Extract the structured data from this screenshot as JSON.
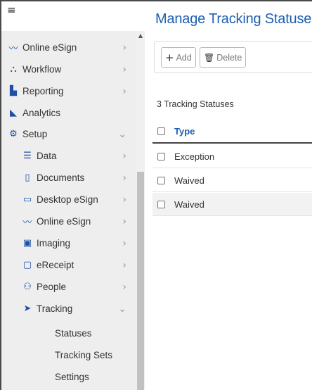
{
  "app": {
    "menu_glyph": "≡"
  },
  "sidebar": {
    "items": [
      {
        "label": "Online eSign",
        "icon": "signature-icon",
        "glyph": "〰",
        "chevron": "›"
      },
      {
        "label": "Workflow",
        "icon": "sitemap-icon",
        "glyph": "⛬",
        "chevron": "›"
      },
      {
        "label": "Reporting",
        "icon": "file-icon",
        "glyph": "▙",
        "chevron": "›"
      },
      {
        "label": "Analytics",
        "icon": "area-chart-icon",
        "glyph": "◣",
        "chevron": ""
      },
      {
        "label": "Setup",
        "icon": "gear-icon",
        "glyph": "⚙",
        "chevron": "⌄"
      }
    ],
    "setup_items": [
      {
        "label": "Data",
        "icon": "database-icon",
        "glyph": "☰",
        "chevron": "›"
      },
      {
        "label": "Documents",
        "icon": "clipboard-icon",
        "glyph": "▯",
        "chevron": "›"
      },
      {
        "label": "Desktop eSign",
        "icon": "desktop-icon",
        "glyph": "▭",
        "chevron": "›"
      },
      {
        "label": "Online eSign",
        "icon": "signature-icon",
        "glyph": "〰",
        "chevron": "›"
      },
      {
        "label": "Imaging",
        "icon": "image-icon",
        "glyph": "▣",
        "chevron": "›"
      },
      {
        "label": "eReceipt",
        "icon": "receipt-icon",
        "glyph": "▢",
        "chevron": "›"
      },
      {
        "label": "People",
        "icon": "users-icon",
        "glyph": "⚇",
        "chevron": "›"
      },
      {
        "label": "Tracking",
        "icon": "location-arrow-icon",
        "glyph": "➤",
        "chevron": "⌄"
      }
    ],
    "tracking_items": [
      {
        "label": "Statuses"
      },
      {
        "label": "Tracking Sets"
      },
      {
        "label": "Settings"
      }
    ],
    "scroll_up_glyph": "▲"
  },
  "main": {
    "title": "Manage Tracking Statuses",
    "toolbar": {
      "add_label": "Add",
      "add_glyph": "+",
      "delete_label": "Delete",
      "delete_glyph": "🗑"
    },
    "count_text": "3 Tracking Statuses",
    "table": {
      "header": "Type",
      "rows": [
        "Exception",
        "Waived",
        "Waived"
      ]
    }
  },
  "colors": {
    "accent": "#1d5fb3",
    "icon": "#1d4fa3",
    "sidebar_bg": "#eeeeee"
  }
}
